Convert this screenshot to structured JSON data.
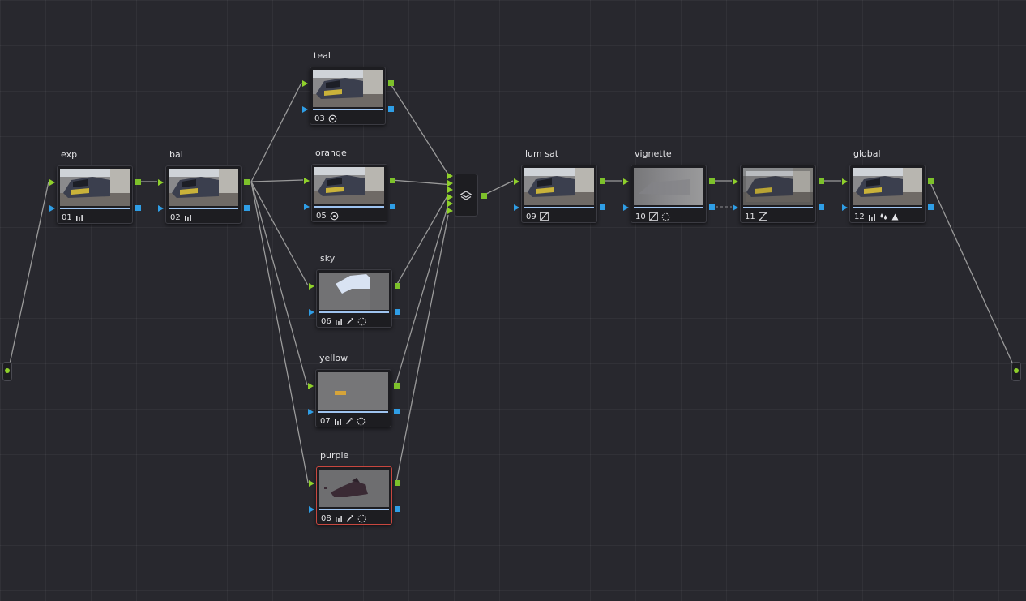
{
  "app": {
    "view": "Node Graph",
    "colors": {
      "canvas": "#28282e",
      "node_body": "#1d1d21",
      "rgb_output_port": "#7dc12b",
      "key_output_port": "#2f9ee6",
      "selected_border": "#c8473f",
      "connection_line": "#9a9a9a"
    }
  },
  "nodes": [
    {
      "id": "n01",
      "label": "exp",
      "number": "01",
      "tools": [
        "curves-bars-icon"
      ],
      "thumb": "train"
    },
    {
      "id": "n02",
      "label": "bal",
      "number": "02",
      "tools": [
        "curves-bars-icon"
      ],
      "thumb": "train"
    },
    {
      "id": "n03",
      "label": "teal",
      "number": "03",
      "tools": [
        "circle-window-icon"
      ],
      "thumb": "train"
    },
    {
      "id": "n05",
      "label": "orange",
      "number": "05",
      "tools": [
        "circle-window-icon"
      ],
      "thumb": "train"
    },
    {
      "id": "n06",
      "label": "sky",
      "number": "06",
      "tools": [
        "curves-bars-icon",
        "eyedropper-icon",
        "dashed-circle-icon"
      ],
      "thumb": "sky"
    },
    {
      "id": "n07",
      "label": "yellow",
      "number": "07",
      "tools": [
        "curves-bars-icon",
        "eyedropper-icon",
        "dashed-circle-icon"
      ],
      "thumb": "yellow"
    },
    {
      "id": "n08",
      "label": "purple",
      "number": "08",
      "tools": [
        "curves-bars-icon",
        "eyedropper-icon",
        "dashed-circle-icon"
      ],
      "thumb": "purple",
      "selected": true
    },
    {
      "id": "n09",
      "label": "lum sat",
      "number": "09",
      "tools": [
        "custom-curve-icon"
      ],
      "thumb": "train"
    },
    {
      "id": "n10",
      "label": "vignette",
      "number": "10",
      "tools": [
        "custom-curve-icon",
        "dashed-circle-icon"
      ],
      "thumb": "blur"
    },
    {
      "id": "n11",
      "label": "",
      "number": "11",
      "tools": [
        "custom-curve-icon"
      ],
      "thumb": "train-vignette"
    },
    {
      "id": "n12",
      "label": "global",
      "number": "12",
      "tools": [
        "curves-bars-icon",
        "drops-icon",
        "triangle-icon"
      ],
      "thumb": "train"
    }
  ],
  "layer_mixer": {
    "label": "",
    "icon": "layers-icon",
    "inputs": 6
  },
  "source_input": {
    "icon": "green-dot"
  },
  "output": {
    "icon": "green-dot"
  }
}
